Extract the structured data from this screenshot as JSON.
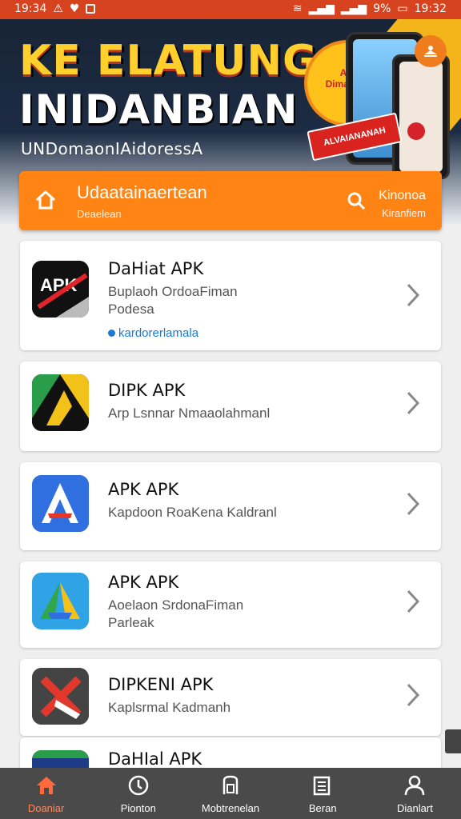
{
  "status_bar": {
    "time_left": "19:34",
    "battery_pct": "9%",
    "time_right": "19:32"
  },
  "banner": {
    "line1": "KE ELATUNG",
    "line2": "INIDANBIAN",
    "line3": "UNDomaonIAidoressA",
    "circle_text": "Aik Dimaraan",
    "ribbon_text": "ALVAIANANAH"
  },
  "feature_bar": {
    "title": "Udaatainaertean",
    "subtitle": "Deaelean",
    "right_top": "Kinonoa",
    "right_bottom": "Kiranfiem"
  },
  "apps": [
    {
      "name": "DaHiat APK",
      "desc_line1": "Buplaoh OrdoaFiman",
      "desc_line2": "Podesa",
      "meta": "kardorerlamala"
    },
    {
      "name": "DIPK APK",
      "desc_line1": "Arp Lsnnar Nmaaolahmanl",
      "desc_line2": ""
    },
    {
      "name": "APK APK",
      "desc_line1": "Kapdoon RoaKena Kaldranl",
      "desc_line2": ""
    },
    {
      "name": "APK APK",
      "desc_line1": "Aoelaon SrdonaFiman",
      "desc_line2": "Parleak"
    },
    {
      "name": "DIPKENI APK",
      "desc_line1": "Kaplsrmal Kadmanh",
      "desc_line2": ""
    },
    {
      "name": "DaHIal APK",
      "desc_line1": "",
      "desc_line2": ""
    }
  ],
  "nav": [
    {
      "label": "Doaniar",
      "icon": "home-icon",
      "active": true
    },
    {
      "label": "Pionton",
      "icon": "clock-icon"
    },
    {
      "label": "Mobtrenelan",
      "icon": "phone-icon"
    },
    {
      "label": "Beran",
      "icon": "list-icon"
    },
    {
      "label": "Dianlart",
      "icon": "user-icon"
    }
  ],
  "colors": {
    "status_bar": "#d8431f",
    "accent_orange": "#ff8414",
    "nav_bg": "#4a4a4a",
    "link_blue": "#1a7ad2"
  }
}
